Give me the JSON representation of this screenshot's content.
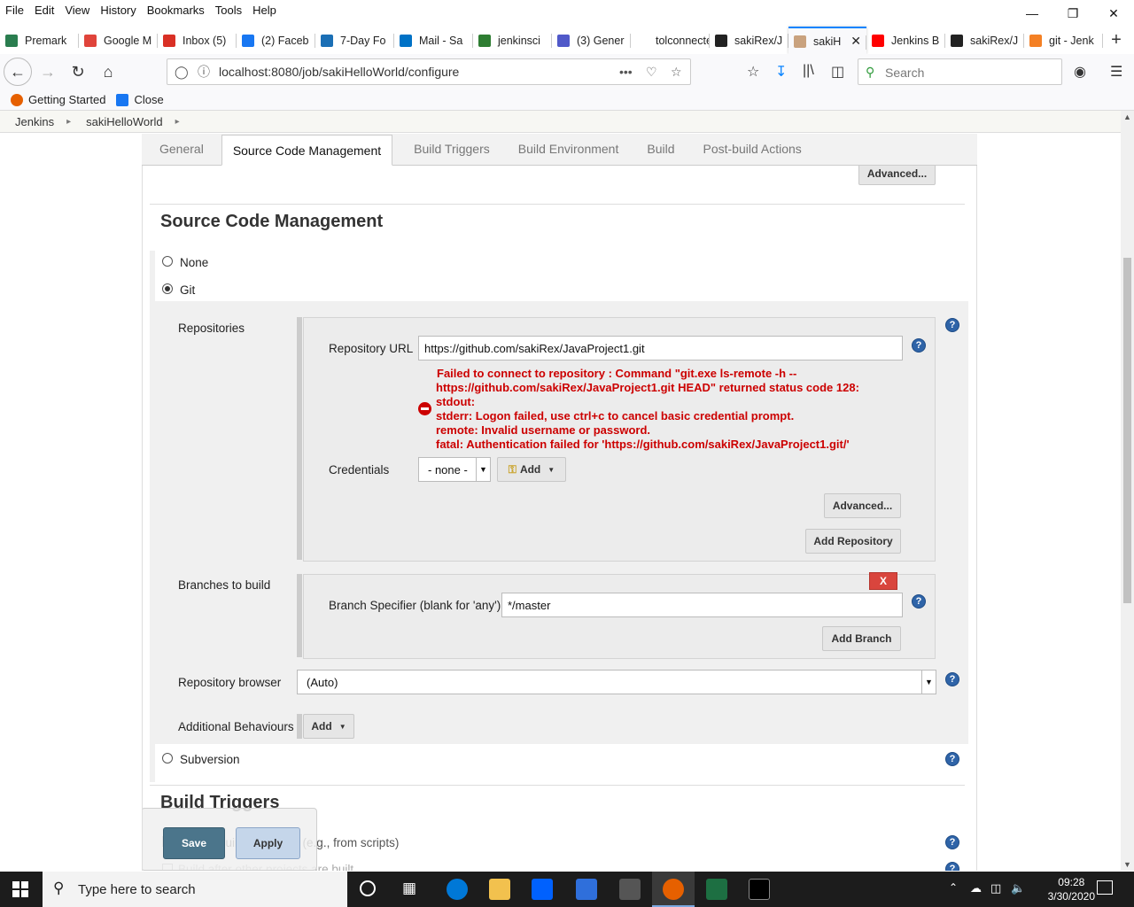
{
  "menubar": [
    "File",
    "Edit",
    "View",
    "History",
    "Bookmarks",
    "Tools",
    "Help"
  ],
  "tabs": [
    {
      "title": "Premark",
      "color": "#2a7d4f"
    },
    {
      "title": "Google M",
      "color": "#e0443b"
    },
    {
      "title": "Inbox (5)",
      "color": "#d93025"
    },
    {
      "title": "(2) Faceb",
      "color": "#1877f2"
    },
    {
      "title": "7-Day Fo",
      "color": "#1b6fb5"
    },
    {
      "title": "Mail - Sa",
      "color": "#0072c6"
    },
    {
      "title": "jenkinsci",
      "color": "#2e7d32"
    },
    {
      "title": "(3) Gener",
      "color": "#5059c9"
    },
    {
      "title": "tolconnected",
      "color": "#ffffff"
    },
    {
      "title": "sakiRex/J",
      "color": "#222222"
    },
    {
      "title": "sakiH",
      "color": "#c9a27e",
      "active": true
    },
    {
      "title": "Jenkins B",
      "color": "#ff0000"
    },
    {
      "title": "sakiRex/J",
      "color": "#222222"
    },
    {
      "title": "git - Jenk",
      "color": "#f48024"
    }
  ],
  "url": "localhost:8080/job/sakiHelloWorld/configure",
  "search_placeholder": "Search",
  "bookmarks": [
    {
      "label": "Getting Started",
      "color": "#e66000"
    },
    {
      "label": "Close",
      "color": "#1877f2"
    }
  ],
  "breadcrumb": [
    "Jenkins",
    "sakiHelloWorld"
  ],
  "config_tabs": [
    "General",
    "Source Code Management",
    "Build Triggers",
    "Build Environment",
    "Build",
    "Post-build Actions"
  ],
  "active_tab": "Source Code Management",
  "top_advanced": "Advanced...",
  "scm": {
    "section_title": "Source Code Management",
    "none_label": "None",
    "git_label": "Git",
    "repositories_label": "Repositories",
    "repo_url_label": "Repository URL",
    "repo_url_value": "https://github.com/sakiRex/JavaProject1.git",
    "error_lines": [
      "Failed to connect to repository : Command \"git.exe ls-remote -h --",
      "https://github.com/sakiRex/JavaProject1.git HEAD\" returned status code 128:",
      "stdout:",
      "stderr: Logon failed, use ctrl+c to cancel basic credential prompt.",
      "remote: Invalid username or password.",
      "fatal: Authentication failed for 'https://github.com/sakiRex/JavaProject1.git/'"
    ],
    "credentials_label": "Credentials",
    "credentials_value": "- none -",
    "add_label": "Add",
    "advanced_label": "Advanced...",
    "add_repository_label": "Add Repository",
    "branches_label": "Branches to build",
    "delete_label": "X",
    "branch_spec_label": "Branch Specifier (blank for 'any')",
    "branch_spec_value": "*/master",
    "add_branch_label": "Add Branch",
    "repo_browser_label": "Repository browser",
    "repo_browser_value": "(Auto)",
    "additional_behaviours_label": "Additional Behaviours",
    "additional_add_label": "Add",
    "subversion_label": "Subversion"
  },
  "build_triggers": {
    "title": "Build Triggers",
    "trigger1": "Trigger builds remotely (e.g., from scripts)",
    "trigger2": "Build after other projects are built"
  },
  "save_label": "Save",
  "apply_label": "Apply",
  "help_glyph": "?",
  "taskbar": {
    "search_text": "Type here to search",
    "time": "09:28",
    "date": "3/30/2020"
  }
}
